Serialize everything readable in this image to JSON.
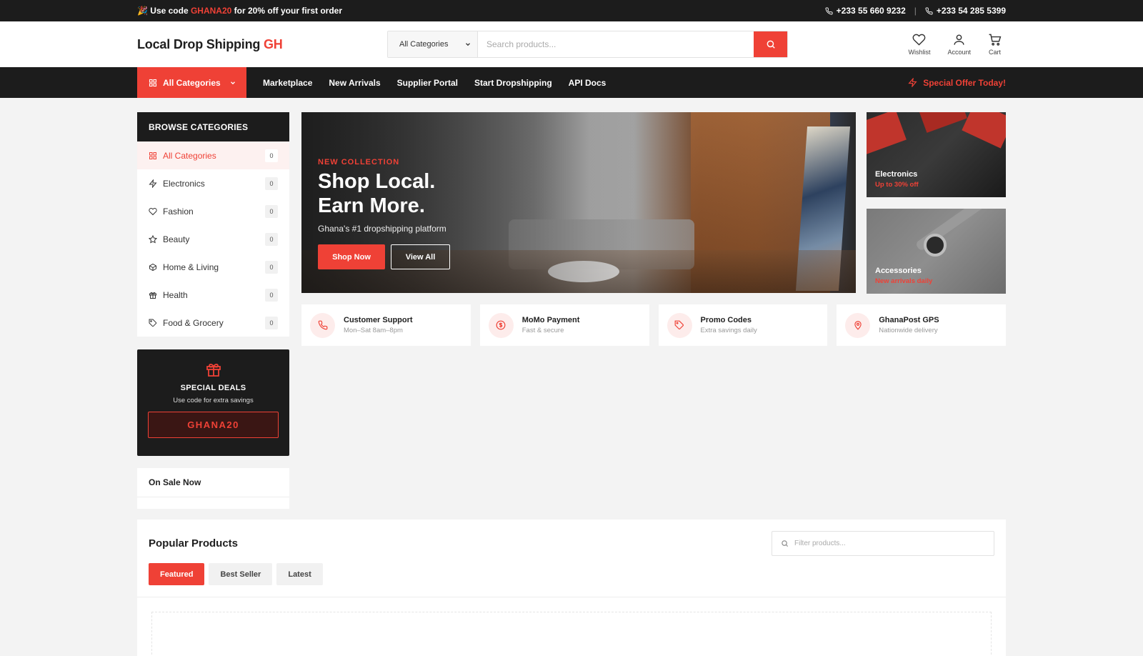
{
  "topbar": {
    "promo_prefix": "🎉 Use code ",
    "promo_code": "GHANA20",
    "promo_suffix": " for 20% off your first order",
    "phone1": "+233 55 660 9232",
    "separator": "|",
    "phone2": "+233 54 285 5399"
  },
  "header": {
    "logo_main": "Local Drop Shipping ",
    "logo_accent": "GH",
    "search_category": "All Categories",
    "search_placeholder": "Search products...",
    "icons": [
      {
        "label": "Wishlist",
        "icon": "heart-icon"
      },
      {
        "label": "Account",
        "icon": "user-icon"
      },
      {
        "label": "Cart",
        "icon": "cart-icon"
      }
    ]
  },
  "nav": {
    "all_categories": "All Categories",
    "links": [
      "Marketplace",
      "New Arrivals",
      "Supplier Portal",
      "Start Dropshipping",
      "API Docs"
    ],
    "special": "Special Offer Today!"
  },
  "sidebar": {
    "title": "BROWSE CATEGORIES",
    "items": [
      {
        "label": "All Categories",
        "count": "0",
        "icon": "grid-icon",
        "active": true
      },
      {
        "label": "Electronics",
        "count": "0",
        "icon": "bolt-icon"
      },
      {
        "label": "Fashion",
        "count": "0",
        "icon": "heart-icon"
      },
      {
        "label": "Beauty",
        "count": "0",
        "icon": "star-icon"
      },
      {
        "label": "Home & Living",
        "count": "0",
        "icon": "box-icon"
      },
      {
        "label": "Health",
        "count": "0",
        "icon": "gift-icon"
      },
      {
        "label": "Food & Grocery",
        "count": "0",
        "icon": "tag-icon"
      }
    ],
    "deals": {
      "title": "SPECIAL DEALS",
      "subtitle": "Use code for extra savings",
      "code": "GHANA20"
    },
    "on_sale": "On Sale Now"
  },
  "hero": {
    "tag": "NEW COLLECTION",
    "line1": "Shop Local.",
    "line2": "Earn More.",
    "subtitle": "Ghana's #1 dropshipping platform",
    "primary_button": "Shop Now",
    "secondary_button": "View All"
  },
  "promo_cards": [
    {
      "name": "Electronics",
      "detail": "Up to 30% off"
    },
    {
      "name": "Accessories",
      "detail": "New arrivals daily"
    }
  ],
  "features": [
    {
      "title": "Customer Support",
      "subtitle": "Mon–Sat 8am–8pm",
      "icon": "phone-icon"
    },
    {
      "title": "MoMo Payment",
      "subtitle": "Fast & secure",
      "icon": "money-icon"
    },
    {
      "title": "Promo Codes",
      "subtitle": "Extra savings daily",
      "icon": "tag-icon"
    },
    {
      "title": "GhanaPost GPS",
      "subtitle": "Nationwide delivery",
      "icon": "location-icon"
    }
  ],
  "products": {
    "title": "Popular Products",
    "filter_placeholder": "Filter products...",
    "tabs": [
      "Featured",
      "Best Seller",
      "Latest"
    ]
  },
  "colors": {
    "accent": "#ef4136",
    "dark": "#1c1c1c"
  }
}
